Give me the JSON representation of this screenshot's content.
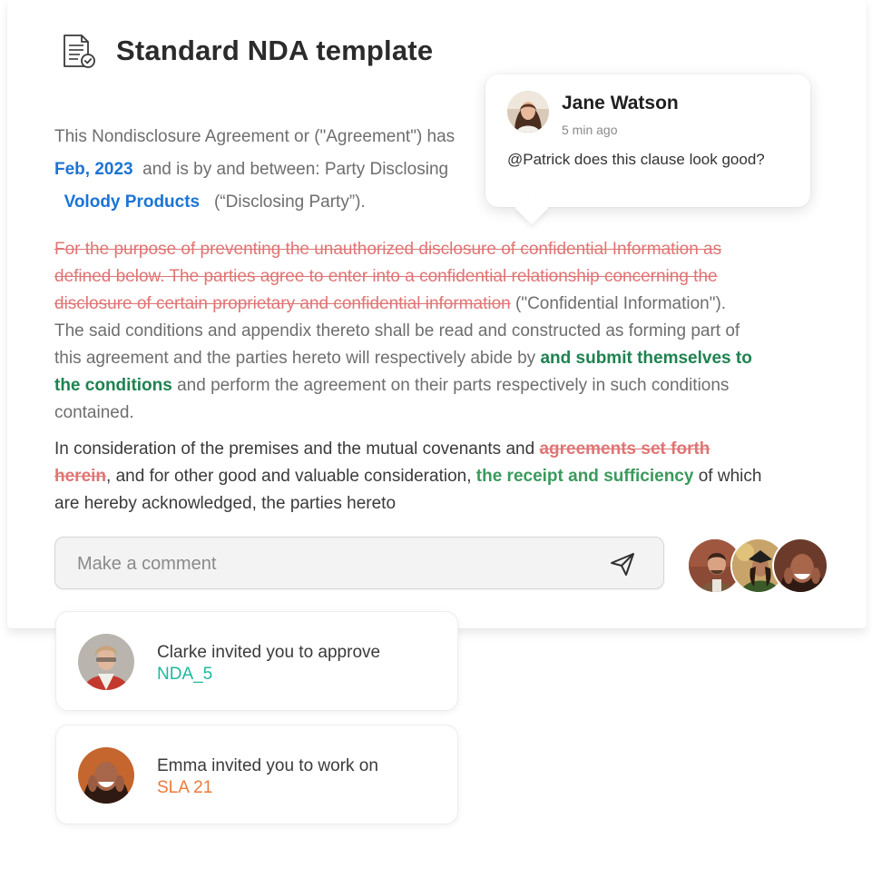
{
  "document": {
    "title": "Standard NDA template",
    "icon": "document-check-icon",
    "intro": {
      "line1": "This Nondisclosure Agreement or (\"Agreement\") has",
      "date": "Feb, 2023",
      "line2_rest": "and is by and between: Party Disclosing",
      "party": "Volody Products",
      "line3_rest": "(“Disclosing Party”)."
    },
    "paragraph1": {
      "deleted_line1": "For the purpose of preventing the unauthorized disclosure of confidential Information as",
      "deleted_line2": "defined below. The parties agree to enter into a confidential relationship concerning the",
      "deleted_line3": "disclosure of certain proprietary and confidential information",
      "line3_rest": " (\"Confidential Information\").",
      "line4": "The said conditions and appendix thereto shall be read and constructed as forming part of",
      "line5": "this agreement and the parties hereto will respectively abide by ",
      "inserted_line5": "and submit themselves to",
      "inserted_line6": "the conditions",
      "line6_rest": " and perform the agreement on their parts respectively in such conditions",
      "line7": "contained."
    },
    "paragraph2": {
      "line1": "In consideration of the premises and the mutual covenants and ",
      "deleted_line1": "agreements set forth",
      "deleted_line2": "herein",
      "line2_mid": ", and for other good and valuable consideration, ",
      "inserted_line2": "the receipt and sufficiency",
      "line2_rest": " of which",
      "line3": "are hereby acknowledged, the parties hereto"
    }
  },
  "comment_bubble": {
    "author": "Jane Watson",
    "time": "5 min ago",
    "text": "@Patrick does this clause look good?"
  },
  "comment_input": {
    "placeholder": "Make a comment",
    "value": ""
  },
  "notifications": [
    {
      "text": "Clarke invited you to approve",
      "link": "NDA_5",
      "link_color": "#1cb89e"
    },
    {
      "text": "Emma invited you to work on",
      "link": "SLA 21",
      "link_color": "#ec7a3a"
    }
  ],
  "colors": {
    "deleted": "#e07474",
    "inserted": "#1e8250",
    "highlight_blue": "#1b74d6"
  }
}
